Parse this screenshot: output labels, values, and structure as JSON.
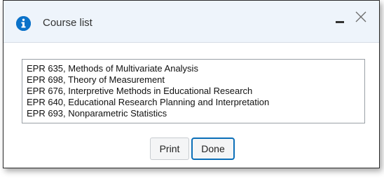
{
  "dialog": {
    "title": "Course list",
    "icons": {
      "title_icon": "info-icon",
      "minimize": "minimize-icon",
      "close": "close-icon"
    }
  },
  "courses": [
    "EPR 635, Methods of Multivariate Analysis",
    "EPR 698, Theory of Measurement",
    "EPR 676, Interpretive Methods in Educational Research",
    "EPR 640, Educational Research Planning and Interpretation",
    "EPR 693, Nonparametric Statistics"
  ],
  "buttons": {
    "print": "Print",
    "done": "Done"
  },
  "colors": {
    "accent": "#0b72c9",
    "titlebar_bg": "#eef4fb",
    "focus_border": "#0b6fb8"
  }
}
